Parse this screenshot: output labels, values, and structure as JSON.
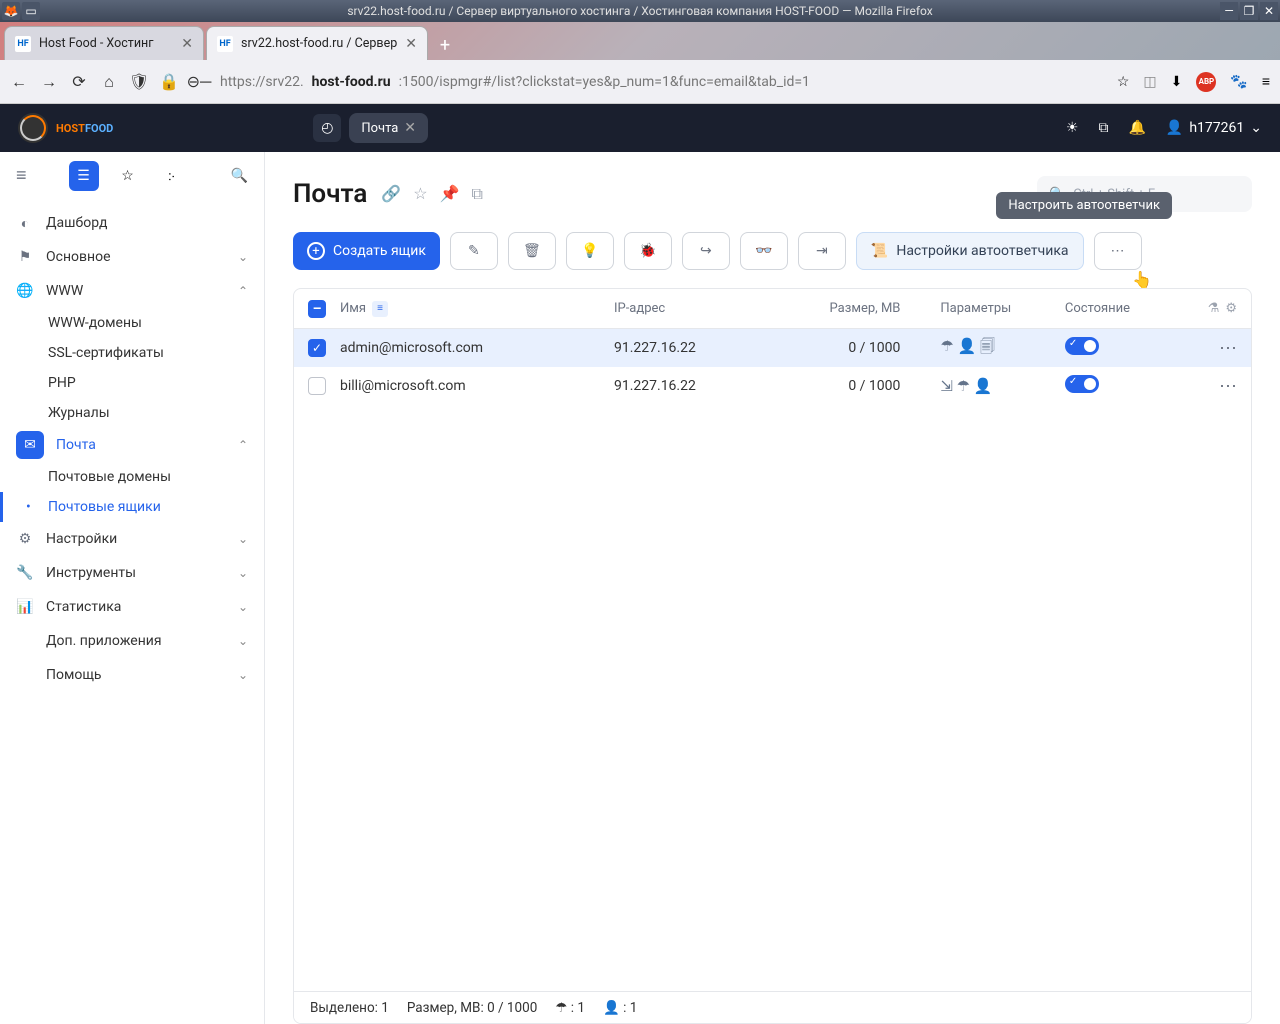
{
  "os": {
    "title": "srv22.host-food.ru / Сервер виртуального хостинга / Хостинговая компания HOST-FOOD — Mozilla Firefox"
  },
  "browser": {
    "tabs": [
      {
        "label": "Host Food - Хостинг",
        "favicon": "HF"
      },
      {
        "label": "srv22.host-food.ru / Сервер",
        "favicon": "HF"
      }
    ],
    "url_prefix": "https://srv22.",
    "url_host": "host-food.ru",
    "url_path": ":1500/ispmgr#/list?clickstat=yes&p_num=1&func=email&tab_id=1"
  },
  "header": {
    "logo_text_a": "HOST",
    "logo_text_b": "FOOD",
    "tab": "Почта",
    "user": "h177261"
  },
  "sidebar": {
    "dashboard": "Дашборд",
    "main": "Основное",
    "www": "WWW",
    "www_items": [
      "WWW-домены",
      "SSL-сертификаты",
      "PHP",
      "Журналы"
    ],
    "mail": "Почта",
    "mail_items": [
      "Почтовые домены",
      "Почтовые ящики"
    ],
    "settings": "Настройки",
    "tools": "Инструменты",
    "stats": "Статистика",
    "extra": "Доп. приложения",
    "help": "Помощь"
  },
  "page": {
    "title": "Почта",
    "search_placeholder": "Ctrl + Shift + F",
    "create_btn": "Создать ящик",
    "autoresp_btn": "Настройки автоответчика",
    "tooltip": "Настроить автоответчик"
  },
  "table": {
    "cols": {
      "name": "Имя",
      "ip": "IP-адрес",
      "size": "Размер, МВ",
      "params": "Параметры",
      "state": "Состояние"
    },
    "rows": [
      {
        "checked": true,
        "name": "admin@microsoft.com",
        "ip": "91.227.16.22",
        "size": "0 / 1000",
        "icons": "☂ 👤 🗐"
      },
      {
        "checked": false,
        "name": "billi@microsoft.com",
        "ip": "91.227.16.22",
        "size": "0 / 1000",
        "icons": "⇲ ☂ 👤"
      }
    ]
  },
  "status": {
    "selected": "Выделено: 1",
    "size": "Размер, МВ: 0 / 1000",
    "umbrella": "☂ : 1",
    "user": "👤 : 1"
  }
}
